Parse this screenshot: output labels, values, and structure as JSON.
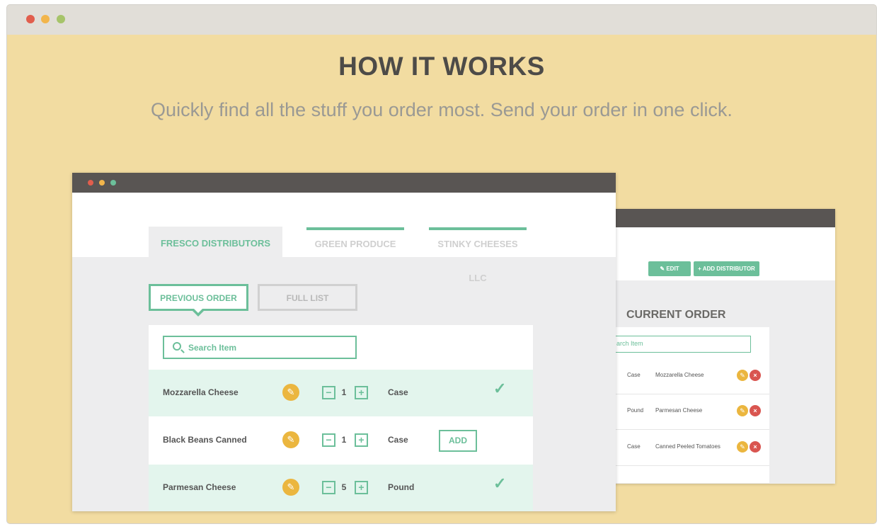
{
  "hero": {
    "title": "HOW IT WORKS",
    "subtitle": "Quickly find all the stuff you order most. Send your order in one click."
  },
  "front_window": {
    "tabs": [
      {
        "label": "FRESCO DISTRIBUTORS",
        "active": true
      },
      {
        "label": "GREEN PRODUCE",
        "active": false
      },
      {
        "label": "STINKY CHEESES LLC",
        "active": false
      }
    ],
    "subtabs": {
      "previous_order": "PREVIOUS ORDER",
      "full_list": "FULL LIST"
    },
    "search_placeholder": "Search Item",
    "items": [
      {
        "name": "Mozzarella Cheese",
        "qty": "1",
        "unit": "Case",
        "state": "added",
        "check": "✓"
      },
      {
        "name": "Black Beans Canned",
        "qty": "1",
        "unit": "Case",
        "state": "not_added",
        "add_label": "ADD"
      },
      {
        "name": "Parmesan Cheese",
        "qty": "5",
        "unit": "Pound",
        "state": "added",
        "check": "✓"
      }
    ],
    "icons": {
      "edit": "pencil-icon",
      "decrement": "minus-icon",
      "increment": "plus-icon",
      "added": "check-icon",
      "search": "search-icon"
    }
  },
  "back_window": {
    "edit_label": "✎ EDIT",
    "add_distributor_label": "+ ADD DISTRIBUTOR",
    "current_order_title": "CURRENT ORDER",
    "search_placeholder": "arch Item",
    "order_items": [
      {
        "unit": "Case",
        "name": "Mozzarella Cheese"
      },
      {
        "unit": "Pound",
        "name": "Parmesan Cheese"
      },
      {
        "unit": "Case",
        "name": "Canned Peeled Tomatoes"
      }
    ]
  },
  "colors": {
    "accent": "#6cbf9a",
    "background": "#f2dca1",
    "titlebar": "#595553",
    "edit_icon": "#ebb63f",
    "delete_icon": "#d95550",
    "row_highlight": "#e3f5ed"
  }
}
